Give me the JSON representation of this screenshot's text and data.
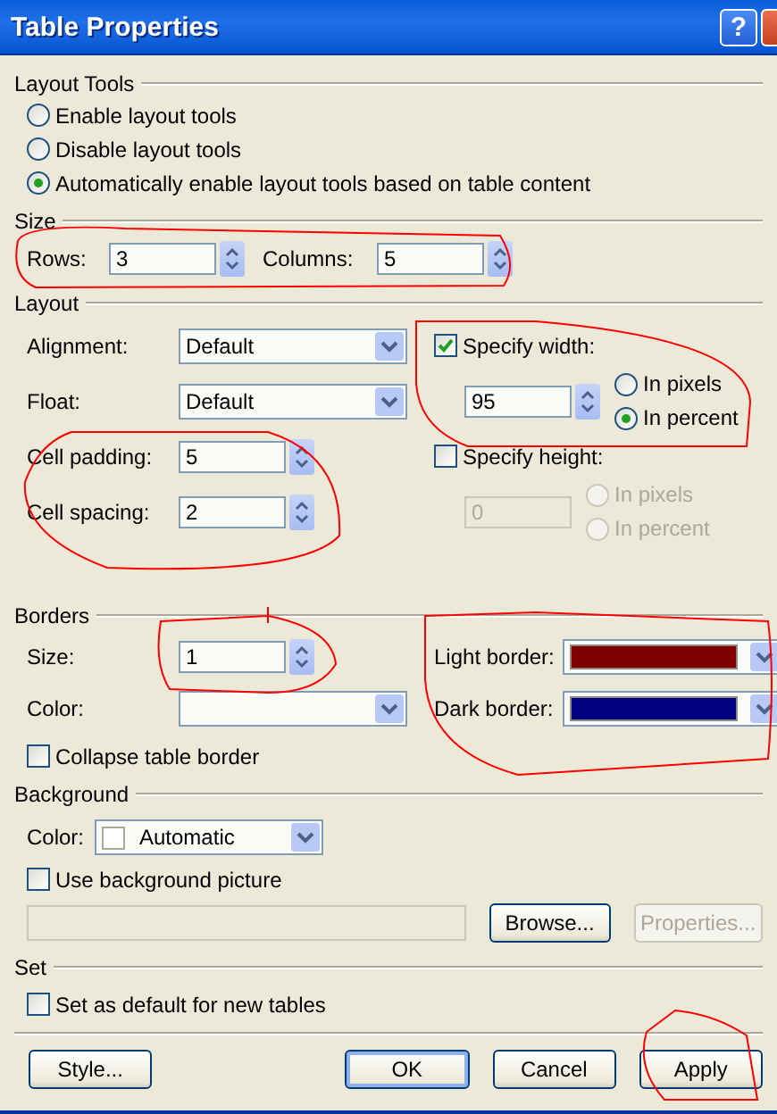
{
  "window": {
    "title": "Table Properties",
    "help": "?"
  },
  "layout_tools": {
    "label": "Layout Tools",
    "options": [
      {
        "label": "Enable layout tools",
        "selected": false
      },
      {
        "label": "Disable layout tools",
        "selected": false
      },
      {
        "label": "Automatically enable layout tools based on table content",
        "selected": true
      }
    ]
  },
  "size": {
    "label": "Size",
    "rows": {
      "label": "Rows:",
      "value": "3"
    },
    "columns": {
      "label": "Columns:",
      "value": "5"
    }
  },
  "layout": {
    "label": "Layout",
    "alignment": {
      "label": "Alignment:",
      "value": "Default"
    },
    "float": {
      "label": "Float:",
      "value": "Default"
    },
    "cell_padding": {
      "label": "Cell padding:",
      "value": "5"
    },
    "cell_spacing": {
      "label": "Cell spacing:",
      "value": "2"
    },
    "specify_width": {
      "label": "Specify width:",
      "checked": true,
      "disabled": false,
      "value": "95",
      "units": [
        {
          "label": "In pixels",
          "selected": false
        },
        {
          "label": "In percent",
          "selected": true
        }
      ]
    },
    "specify_height": {
      "label": "Specify height:",
      "checked": false,
      "disabled": true,
      "value": "0",
      "units": [
        {
          "label": "In pixels",
          "selected": false
        },
        {
          "label": "In percent",
          "selected": false
        }
      ]
    }
  },
  "borders": {
    "label": "Borders",
    "size": {
      "label": "Size:",
      "value": "1"
    },
    "color": {
      "label": "Color:"
    },
    "collapse": {
      "label": "Collapse table border",
      "checked": false
    },
    "light_border": {
      "label": "Light border:",
      "color": "#800000"
    },
    "dark_border": {
      "label": "Dark border:",
      "color": "#000080"
    }
  },
  "background": {
    "label": "Background",
    "color": {
      "label": "Color:",
      "value": "Automatic"
    },
    "use_picture": {
      "label": "Use background picture",
      "checked": false
    },
    "browse": {
      "label": "Browse...",
      "disabled": false
    },
    "properties": {
      "label": "Properties...",
      "disabled": true
    }
  },
  "set": {
    "label": "Set",
    "default": {
      "label": "Set as default for new tables",
      "checked": false
    }
  },
  "buttons": [
    {
      "label": "Style...",
      "default": false
    },
    {
      "label": "OK",
      "default": true
    },
    {
      "label": "Cancel",
      "default": false
    },
    {
      "label": "Apply",
      "default": false
    }
  ]
}
